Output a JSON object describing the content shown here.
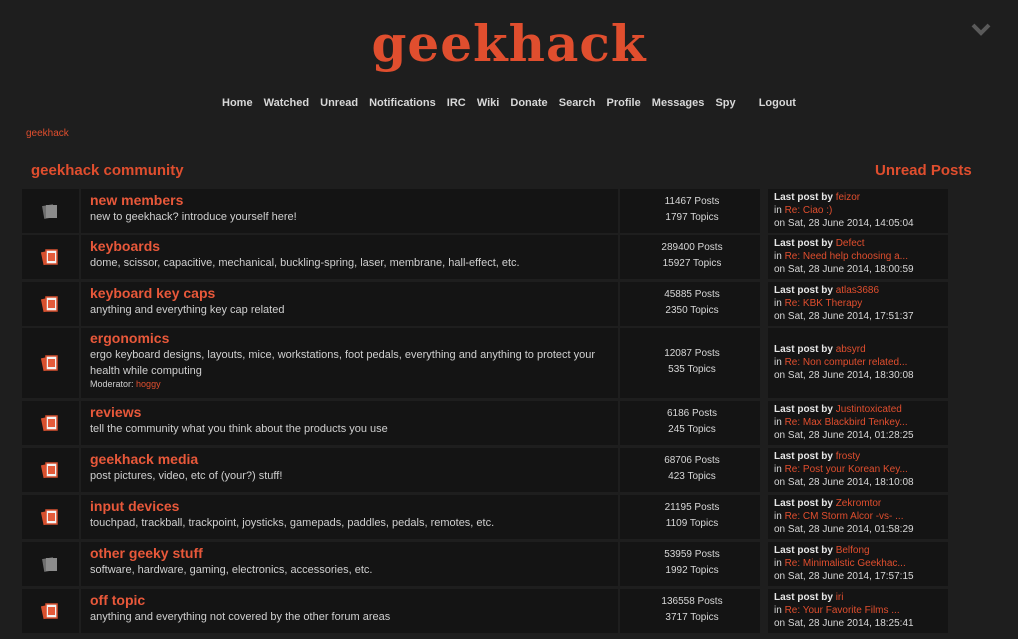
{
  "site": {
    "logo": "geekhack",
    "breadcrumb": "geekhack"
  },
  "nav": [
    "Home",
    "Watched",
    "Unread",
    "Notifications",
    "IRC",
    "Wiki",
    "Donate",
    "Search",
    "Profile",
    "Messages",
    "Spy",
    "Logout"
  ],
  "section": {
    "title": "geekhack community",
    "unread_title": "Unread Posts"
  },
  "labels": {
    "last_post": "Last post",
    "by": "by",
    "in": "in",
    "on": "on",
    "moderator": "Moderator:"
  },
  "forums": [
    {
      "name": "new members",
      "desc": "new to geekhack? introduce yourself here!",
      "posts": "11467 Posts",
      "topics": "1797 Topics",
      "user": "feizor",
      "topic": "Re: Ciao :)",
      "date": "Sat, 28 June 2014, 14:05:04",
      "icon": "read"
    },
    {
      "name": "keyboards",
      "desc": "dome, scissor, capacitive, mechanical, buckling-spring, laser, membrane, hall-effect, etc.",
      "posts": "289400 Posts",
      "topics": "15927 Topics",
      "user": "Defect",
      "topic": "Re: Need help choosing a...",
      "date": "Sat, 28 June 2014, 18:00:59",
      "icon": "new"
    },
    {
      "name": "keyboard key caps",
      "desc": "anything and everything key cap related",
      "posts": "45885 Posts",
      "topics": "2350 Topics",
      "user": "atlas3686",
      "topic": "Re: KBK Therapy",
      "date": "Sat, 28 June 2014, 17:51:37",
      "icon": "new"
    },
    {
      "name": "ergonomics",
      "desc": "ergo keyboard designs, layouts, mice, workstations, foot pedals, everything and anything to protect your health while computing",
      "moderator": "hoggy",
      "posts": "12087 Posts",
      "topics": "535 Topics",
      "user": "absyrd",
      "topic": "Re: Non computer related...",
      "date": "Sat, 28 June 2014, 18:30:08",
      "icon": "new"
    },
    {
      "name": "reviews",
      "desc": "tell the community what you think about the products you use",
      "posts": "6186 Posts",
      "topics": "245 Topics",
      "user": "Justintoxicated",
      "topic": "Re: Max Blackbird Tenkey...",
      "date": "Sat, 28 June 2014, 01:28:25",
      "icon": "new"
    },
    {
      "name": "geekhack media",
      "desc": "post pictures, video, etc of (your?) stuff!",
      "posts": "68706 Posts",
      "topics": "423 Topics",
      "user": "frosty",
      "topic": "Re: Post your Korean Key...",
      "date": "Sat, 28 June 2014, 18:10:08",
      "icon": "new"
    },
    {
      "name": "input devices",
      "desc": "touchpad, trackball, trackpoint, joysticks, gamepads, paddles, pedals, remotes, etc.",
      "posts": "21195 Posts",
      "topics": "1109 Topics",
      "user": "Zekromtor",
      "topic": "Re: CM Storm Alcor -vs- ...",
      "date": "Sat, 28 June 2014, 01:58:29",
      "icon": "new"
    },
    {
      "name": "other geeky stuff",
      "desc": "software, hardware, gaming, electronics, accessories, etc.",
      "posts": "53959 Posts",
      "topics": "1992 Topics",
      "user": "Belfong",
      "topic": "Re: Minimalistic Geekhac...",
      "date": "Sat, 28 June 2014, 17:57:15",
      "icon": "read"
    },
    {
      "name": "off topic",
      "desc": "anything and everything not covered by the other forum areas",
      "posts": "136558 Posts",
      "topics": "3717 Topics",
      "user": "iri",
      "topic": "Re: Your Favorite Films ...",
      "date": "Sat, 28 June 2014, 18:25:41",
      "icon": "new"
    }
  ]
}
